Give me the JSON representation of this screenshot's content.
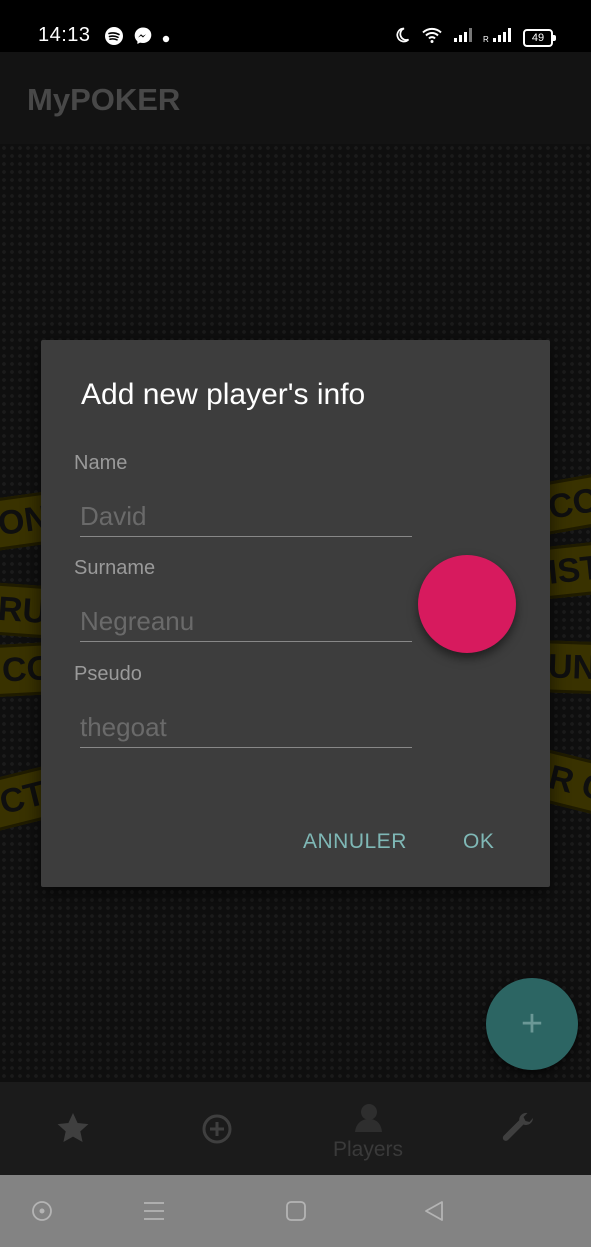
{
  "status_bar": {
    "time": "14:13",
    "battery": "49",
    "icons": [
      "spotify-icon",
      "messenger-icon",
      "dot-icon",
      "moon-icon",
      "wifi-icon",
      "signal-icon",
      "roaming-signal-icon",
      "battery-icon"
    ]
  },
  "app": {
    "title": "MyPOKER"
  },
  "background_tape": [
    "ON",
    "RUC",
    "CO",
    "CTIO",
    "CON",
    "ISTR",
    "UNI",
    "R CO"
  ],
  "dialog": {
    "title": "Add new player's info",
    "fields": [
      {
        "label": "Name",
        "value": "David"
      },
      {
        "label": "Surname",
        "value": "Negreanu"
      },
      {
        "label": "Pseudo",
        "value": "thegoat"
      }
    ],
    "cancel_label": "ANNULER",
    "ok_label": "OK"
  },
  "fab": {
    "icon": "plus-icon",
    "glyph": "+"
  },
  "bottom_nav": {
    "items": [
      {
        "icon": "star-icon",
        "label": ""
      },
      {
        "icon": "add-circle-icon",
        "label": ""
      },
      {
        "icon": "player-icon",
        "label": "Players"
      },
      {
        "icon": "wrench-icon",
        "label": ""
      }
    ]
  },
  "system_nav": [
    "assistant-icon",
    "menu-icon",
    "home-icon",
    "back-icon"
  ],
  "colors": {
    "accent_pink": "#d71a5e",
    "fab": "#2c6563",
    "dialog_button": "#7fb8b6",
    "dialog_bg": "#3d3d3d"
  }
}
